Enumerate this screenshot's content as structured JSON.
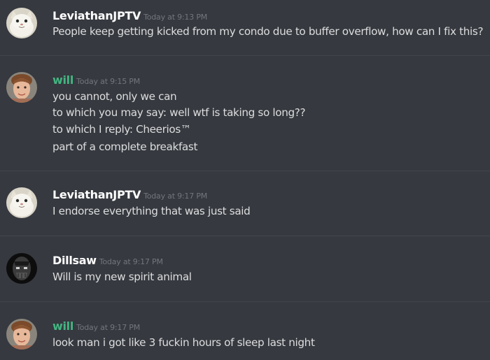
{
  "colors": {
    "background": "#36393f",
    "divider": "#42454b",
    "message_text": "#dcddde",
    "timestamp": "#72767d",
    "username_default": "#ffffff",
    "username_will": "#43b581"
  },
  "messages": [
    {
      "username": "LeviathanJPTV",
      "username_color": "#ffffff",
      "timestamp": "Today at 9:13 PM",
      "avatar_icon": "cat-avatar-icon",
      "lines": [
        "People keep getting kicked from my condo due to buffer overflow, how can I fix this?"
      ]
    },
    {
      "username": "will",
      "username_color": "#43b581",
      "timestamp": "Today at 9:15 PM",
      "avatar_icon": "person-avatar-icon",
      "lines": [
        "you cannot, only we can",
        "to which you may say: well wtf is taking so long??",
        "to which I reply: Cheerios™",
        "part of a complete breakfast"
      ]
    },
    {
      "username": "LeviathanJPTV",
      "username_color": "#ffffff",
      "timestamp": "Today at 9:17 PM",
      "avatar_icon": "cat-avatar-icon",
      "lines": [
        "I endorse everything that was just said"
      ]
    },
    {
      "username": "Dillsaw",
      "username_color": "#ffffff",
      "timestamp": "Today at 9:17 PM",
      "avatar_icon": "masked-figure-avatar-icon",
      "lines": [
        "Will is my new spirit animal"
      ]
    },
    {
      "username": "will",
      "username_color": "#43b581",
      "timestamp": "Today at 9:17 PM",
      "avatar_icon": "person-avatar-icon",
      "lines": [
        "look man i got like 3 fuckin hours of sleep last night"
      ]
    }
  ]
}
